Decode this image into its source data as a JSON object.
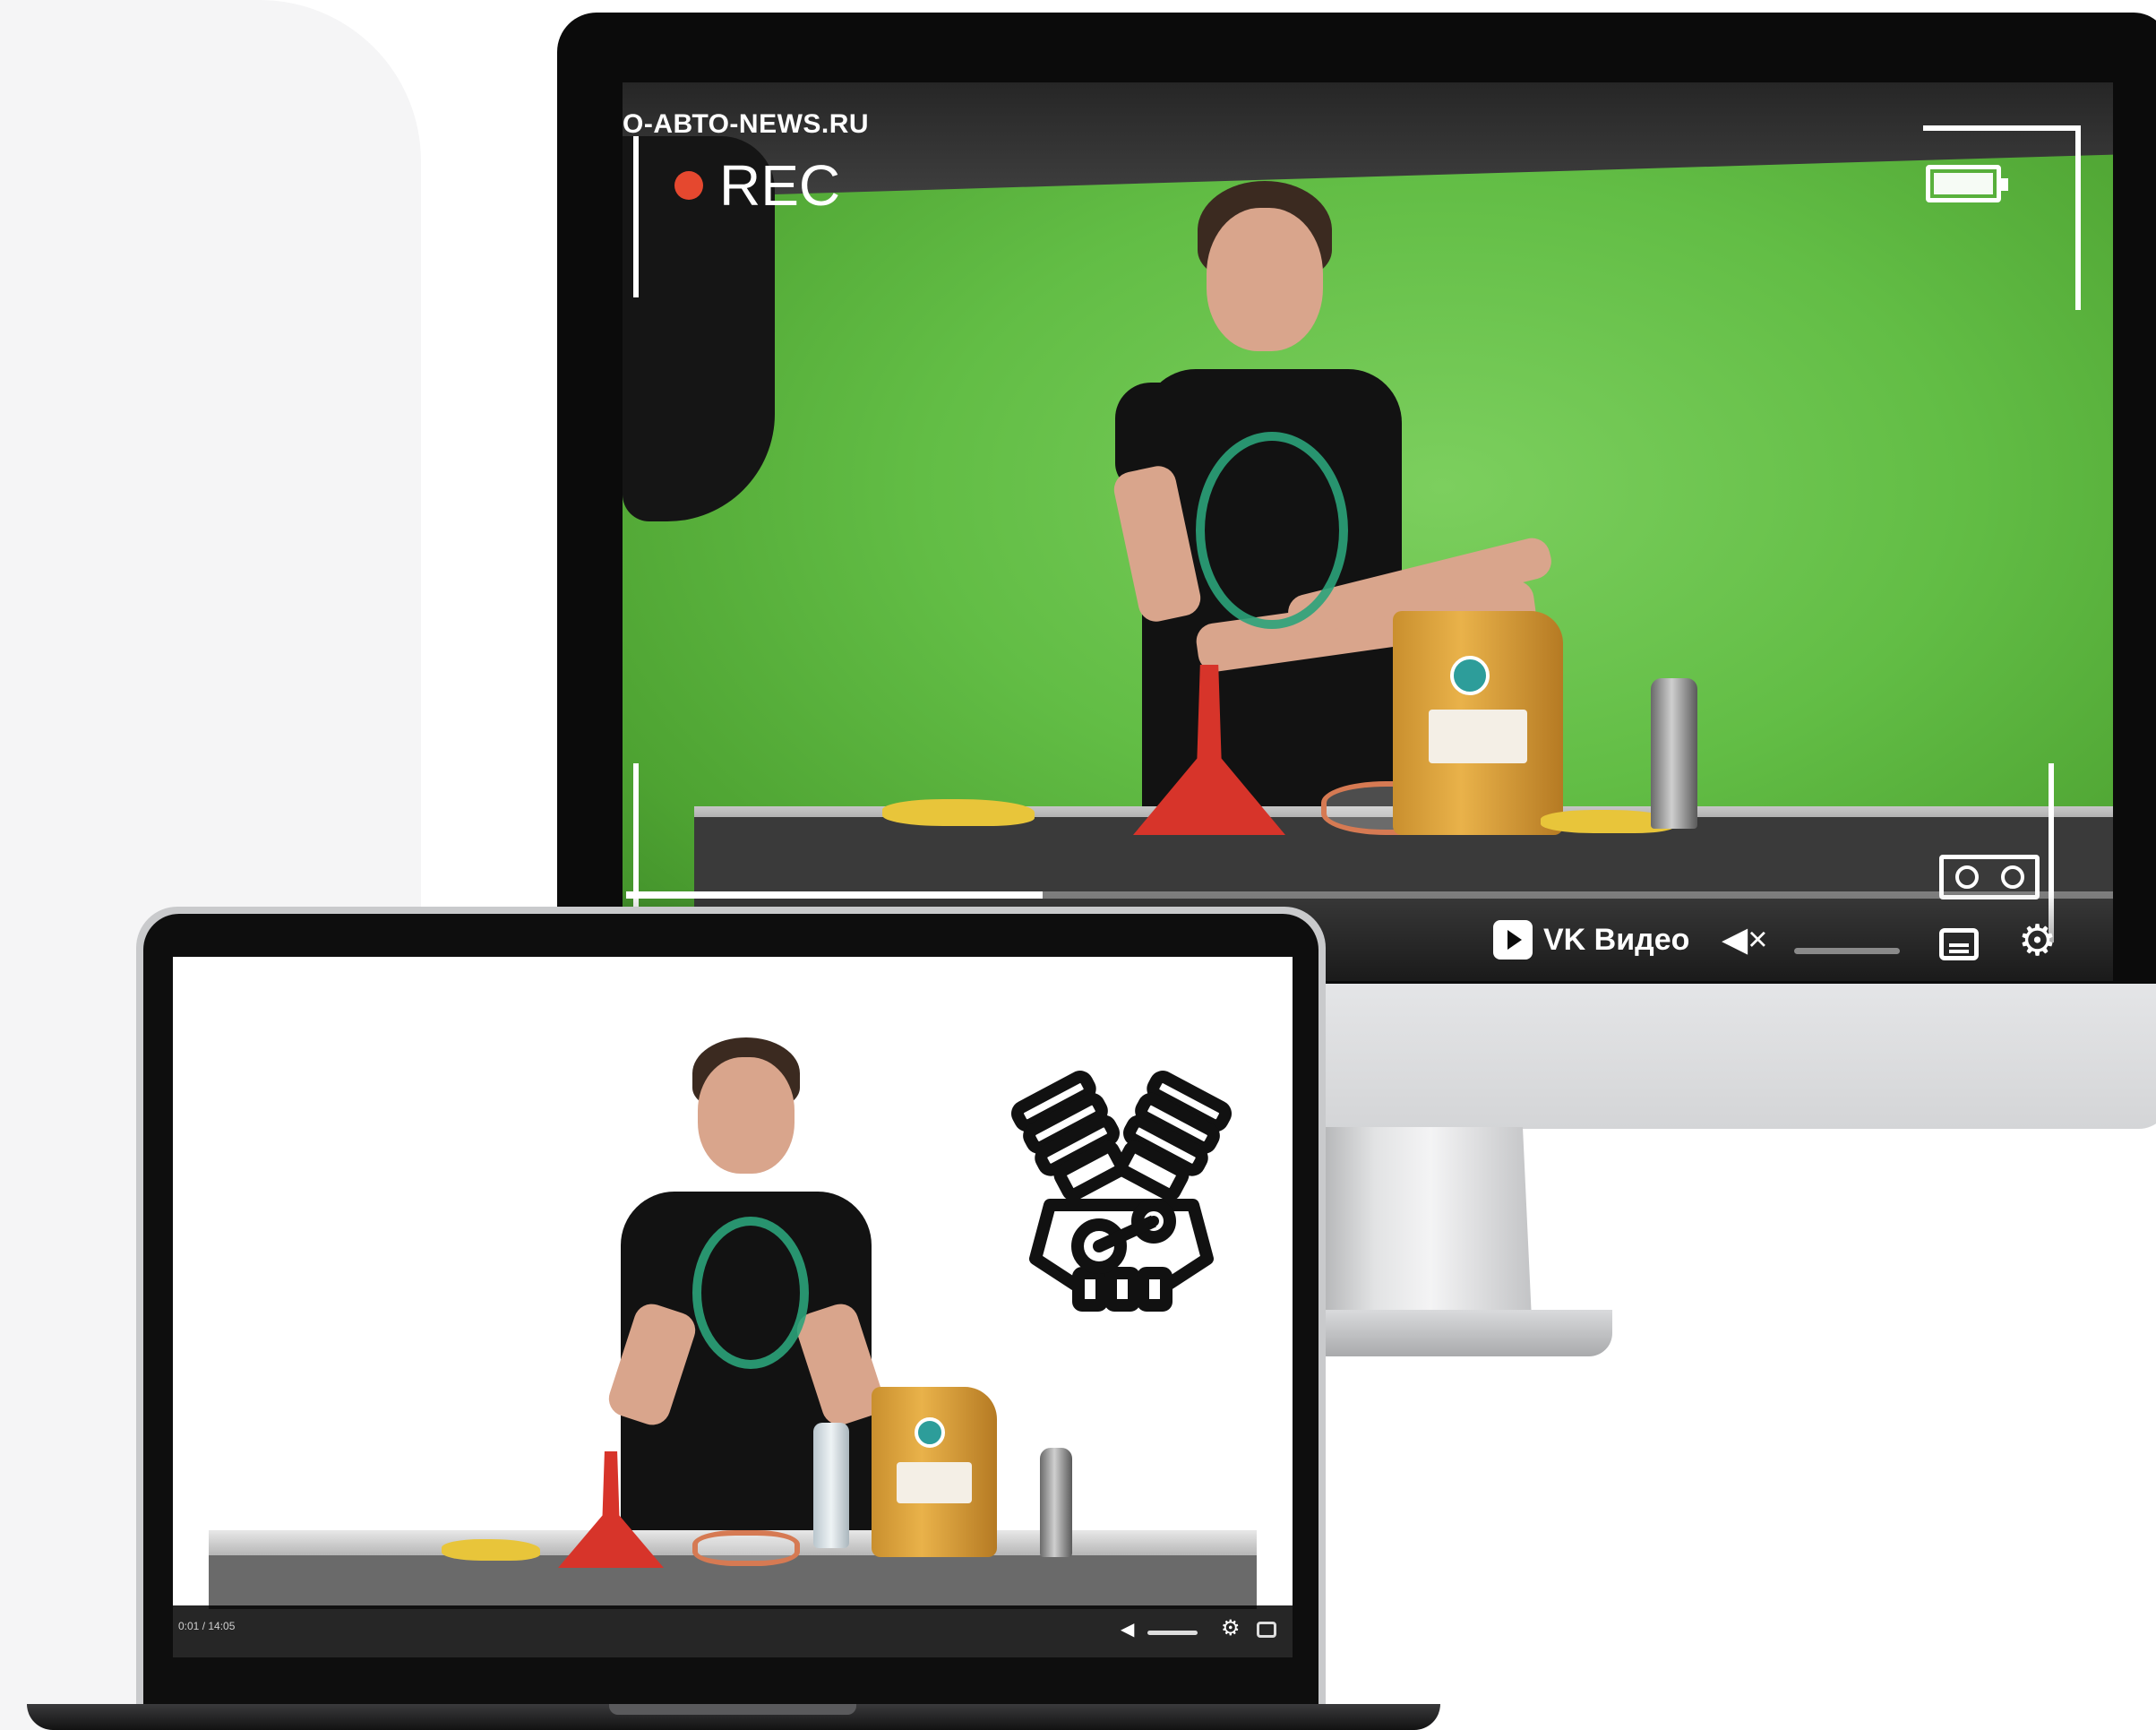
{
  "big_video": {
    "site_watermark": "О-АВТО-NEWS.RU",
    "rec_label": "REC",
    "brand_label": "VK Видео",
    "progress_percent": 28,
    "mute_icon": "mute-icon",
    "settings_icon": "gear-icon",
    "subtitles_icon": "subtitles-icon"
  },
  "small_video": {
    "time_label": "0:01 / 14:05",
    "volume_icon": "volume-icon",
    "settings_icon": "gear-icon",
    "subtitles_icon": "subtitles-icon",
    "overlay_icon": "engine-icon"
  },
  "colors": {
    "green_screen": "#62bd45",
    "rec_dot": "#e5482f",
    "funnel": "#d7342a",
    "oil_can": "#e9b24a",
    "dragon_print": "#2ba37a"
  }
}
